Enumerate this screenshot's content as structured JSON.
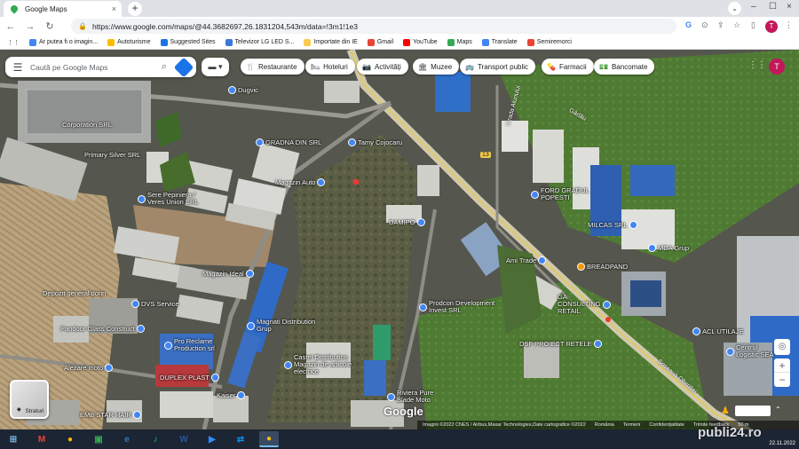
{
  "browser": {
    "tab_title": "Google Maps",
    "tab_close": "×",
    "new_tab": "+",
    "tab_search": "⌄",
    "window_controls": [
      "–",
      "☐",
      "×"
    ],
    "url": "https://www.google.com/maps/@44.3682697,26.1831204,543m/data=!3m1!1e3",
    "profile_initial": "T"
  },
  "bookmarks": [
    {
      "label": "Ar putea fi o imagin...",
      "color": "#4285f4"
    },
    {
      "label": "Autoturisme",
      "color": "#fbbc05"
    },
    {
      "label": "Suggested Sites",
      "color": "#1a73e8"
    },
    {
      "label": "Televizor LG LED S...",
      "color": "#3c78d8"
    },
    {
      "label": "Importate din IE",
      "color": "#f9cb50"
    },
    {
      "label": "Gmail",
      "color": "#ea4335"
    },
    {
      "label": "YouTube",
      "color": "#ff0000"
    },
    {
      "label": "Maps",
      "color": "#34a853"
    },
    {
      "label": "Translate",
      "color": "#4285f4"
    },
    {
      "label": "Semiremorci",
      "color": "#ea4335"
    }
  ],
  "search": {
    "placeholder": "Caută pe Google Maps"
  },
  "chips": [
    {
      "icon": "🍴",
      "label": "Restaurante"
    },
    {
      "icon": "🛏",
      "label": "Hoteluri"
    },
    {
      "icon": "📷",
      "label": "Activități"
    },
    {
      "icon": "🏛",
      "label": "Muzee"
    },
    {
      "icon": "🚌",
      "label": "Transport public"
    },
    {
      "icon": "💊",
      "label": "Farmacii"
    },
    {
      "icon": "💵",
      "label": "Bancomate"
    }
  ],
  "map_labels": [
    {
      "text": "Dugvic",
      "pin": "blue"
    },
    {
      "text": "Corporation SRL",
      "pin": "none"
    },
    {
      "text": "Primary Silver SRL",
      "pin": "none"
    },
    {
      "text": "GRADNA DIN SRL",
      "pin": "blue"
    },
    {
      "text": "Tamy Cojocaru",
      "pin": "blue"
    },
    {
      "text": "Magazin Auto",
      "pin": "blue"
    },
    {
      "text": "Sere Pepiniera / Veres Union SRL",
      "pin": "blue"
    },
    {
      "text": "DAMIPO",
      "pin": "blue"
    },
    {
      "text": "FORD GRADUL POPESTI",
      "pin": "blue"
    },
    {
      "text": "MILCAS SRL",
      "pin": "blue"
    },
    {
      "text": "BREADPAND",
      "pin": "orange"
    },
    {
      "text": "MDA Grup",
      "pin": "blue"
    },
    {
      "text": "Ami Trade",
      "pin": "blue"
    },
    {
      "text": "GA CONSULTING RETAIL",
      "pin": "blue"
    },
    {
      "text": "Magazin Ideal",
      "pin": "blue"
    },
    {
      "text": "Depozit general dorin",
      "pin": "none"
    },
    {
      "text": "DVS Service",
      "pin": "blue"
    },
    {
      "text": "Pandoor Glass Construct",
      "pin": "blue"
    },
    {
      "text": "Magnati Distribution Grup",
      "pin": "blue"
    },
    {
      "text": "Prodcon Development Invest SRL",
      "pin": "blue"
    },
    {
      "text": "Pro Reclame Production srl",
      "pin": "blue"
    },
    {
      "text": "DSF PROIECT RETELE",
      "pin": "blue"
    },
    {
      "text": "ACL UTILAJE",
      "pin": "blue"
    },
    {
      "text": "Centrul Logistic SEA",
      "pin": "blue"
    },
    {
      "text": "Alezare moto",
      "pin": "blue"
    },
    {
      "text": "DUPLEX PLAST",
      "pin": "blue"
    },
    {
      "text": "Castel Distribution Magazin de articole electrice",
      "pin": "blue"
    },
    {
      "text": "Riviera Pure Blade Moto",
      "pin": "blue"
    },
    {
      "text": "Kaiser",
      "pin": "blue"
    },
    {
      "text": "EMB STAR HAIR",
      "pin": "blue"
    }
  ],
  "road_labels": [
    "Strada Alunului",
    "Șoseaua Olteniței",
    "Gârlău",
    "13"
  ],
  "layers_tile": {
    "label": "Straturi"
  },
  "attribution": [
    "Imagini ©2022 CNES / Airbus,Maxar Technologies,Date cartografice ©2022",
    "România",
    "Termeni",
    "Confidențialitate",
    "Trimite feedback",
    "50 m"
  ],
  "google_logo": "Google",
  "zoom": {
    "plus": "+",
    "minus": "−"
  },
  "taskbar": {
    "apps": [
      {
        "name": "start",
        "glyph": "⊞",
        "color": "#76b9ed"
      },
      {
        "name": "gmail",
        "glyph": "M",
        "color": "#ea4335"
      },
      {
        "name": "chrome",
        "glyph": "●",
        "color": "#fbbc05"
      },
      {
        "name": "classroom",
        "glyph": "▣",
        "color": "#34a853"
      },
      {
        "name": "edge",
        "glyph": "e",
        "color": "#3277bc"
      },
      {
        "name": "spotify",
        "glyph": "♪",
        "color": "#1db954"
      },
      {
        "name": "word",
        "glyph": "W",
        "color": "#2b579a"
      },
      {
        "name": "zoom",
        "glyph": "▶",
        "color": "#2d8cff"
      },
      {
        "name": "teamviewer",
        "glyph": "⇄",
        "color": "#0e8ee9"
      },
      {
        "name": "chrome-active",
        "glyph": "●",
        "color": "#fbbc05"
      }
    ],
    "time": "22.11.2022"
  },
  "watermark": "publi24.ro"
}
